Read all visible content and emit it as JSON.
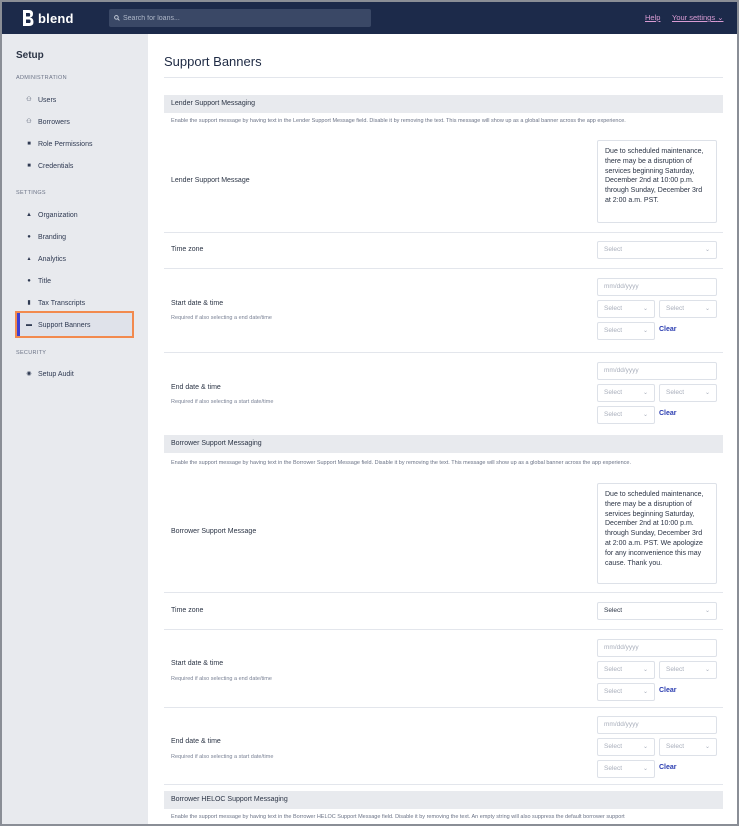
{
  "topbar": {
    "brand": "blend",
    "search_placeholder": "Search for loans...",
    "help": "Help",
    "settings": "Your settings"
  },
  "sidebar": {
    "title": "Setup",
    "sections": {
      "administration": "ADMINISTRATION",
      "settings": "SETTINGS",
      "security": "SECURITY"
    },
    "items": [
      {
        "label": "Users",
        "icon": "users-icon"
      },
      {
        "label": "Borrowers",
        "icon": "borrowers-icon"
      },
      {
        "label": "Role Permissions",
        "icon": "lock-icon"
      },
      {
        "label": "Credentials",
        "icon": "credentials-icon"
      },
      {
        "label": "Organization",
        "icon": "bank-icon"
      },
      {
        "label": "Branding",
        "icon": "palette-icon"
      },
      {
        "label": "Analytics",
        "icon": "analytics-icon"
      },
      {
        "label": "Title",
        "icon": "check-circle-icon"
      },
      {
        "label": "Tax Transcripts",
        "icon": "document-icon"
      },
      {
        "label": "Support Banners",
        "icon": "message-icon"
      },
      {
        "label": "Setup Audit",
        "icon": "audit-icon"
      }
    ]
  },
  "main": {
    "title": "Support Banners",
    "lender": {
      "heading": "Lender Support Messaging",
      "desc": "Enable the support message by having text in the Lender Support Message field. Disable it by removing the text. This message will show up as a global banner across the app experience.",
      "message_label": "Lender Support Message",
      "message": "Due to scheduled maintenance, there may be a disruption of services beginning Saturday, December 2nd at 10:00 p.m. through Sunday, December 3rd at 2:00 a.m. PST.",
      "timezone_label": "Time zone",
      "timezone_value": "Select",
      "start_label": "Start date & time",
      "start_hint": "Required if also selecting a end date/time",
      "end_label": "End date & time",
      "end_hint": "Required if also selecting a start date/time"
    },
    "borrower": {
      "heading": "Borrower Support Messaging",
      "desc": "Enable the support message by having text in the Borrower Support Message field. Disable it by removing the text. This message will show up as a global banner across the app experience.",
      "message_label": "Borrower Support Message",
      "message": "Due to scheduled maintenance, there may be a disruption of services beginning Saturday, December 2nd at 10:00 p.m. through Sunday, December 3rd at 2:00 a.m. PST. We apologize for any inconvenience this may cause. Thank you.",
      "timezone_label": "Time zone",
      "timezone_value": "Select",
      "start_label": "Start date & time",
      "start_hint": "Required if also selecting a end date/time",
      "end_label": "End date & time",
      "end_hint": "Required if also selecting a start date/time"
    },
    "heloc": {
      "heading": "Borrower HELOC Support Messaging",
      "desc": "Enable the support message by having text in the Borrower HELOC Support Message field. Disable it by removing the text. An empty string will also suppress the default borrower support"
    },
    "date_placeholder": "mm/dd/yyyy",
    "select_placeholder": "Select",
    "clear": "Clear"
  }
}
